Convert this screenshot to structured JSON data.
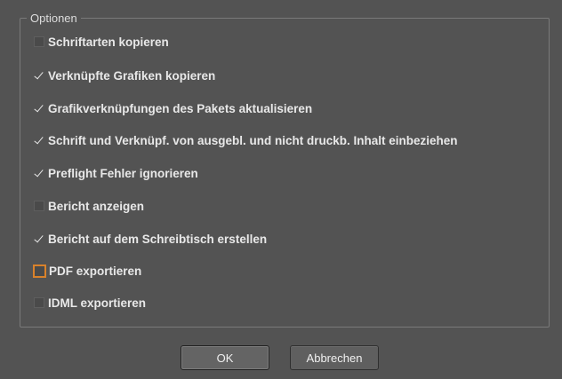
{
  "group": {
    "title": "Optionen"
  },
  "options": [
    {
      "label": "Schriftarten kopieren",
      "checked": false,
      "focused": false
    },
    {
      "label": "Verknüpfte Grafiken kopieren",
      "checked": true,
      "focused": false
    },
    {
      "label": "Grafikverknüpfungen des Pakets aktualisieren",
      "checked": true,
      "focused": false
    },
    {
      "label": "Schrift und Verknüpf. von ausgebl. und nicht druckb. Inhalt einbeziehen",
      "checked": true,
      "focused": false
    },
    {
      "label": "Preflight Fehler ignorieren",
      "checked": true,
      "focused": false
    },
    {
      "label": "Bericht anzeigen",
      "checked": false,
      "focused": false
    },
    {
      "label": "Bericht auf dem Schreibtisch erstellen",
      "checked": true,
      "focused": false
    },
    {
      "label": "PDF exportieren",
      "checked": false,
      "focused": true
    },
    {
      "label": "IDML exportieren",
      "checked": false,
      "focused": false
    }
  ],
  "buttons": {
    "ok_label": "OK",
    "cancel_label": "Abbrechen"
  },
  "colors": {
    "background": "#535353",
    "text": "#e8e8e8",
    "focus_ring": "#d9822b",
    "group_border": "#7a7a7a"
  }
}
